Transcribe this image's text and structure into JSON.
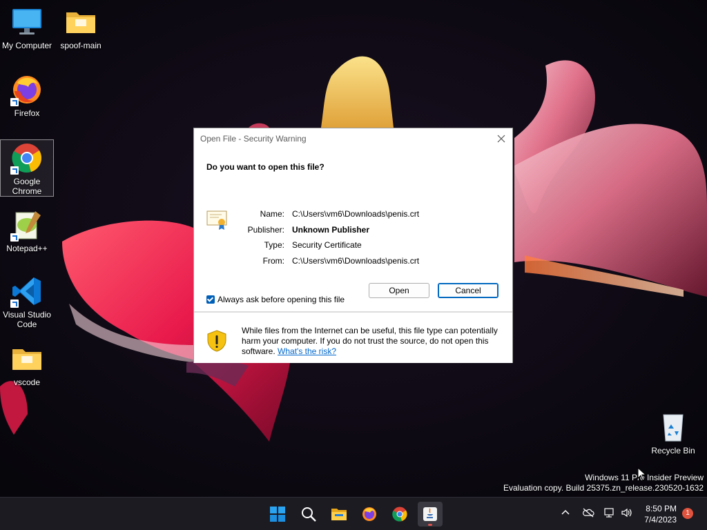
{
  "desktop": {
    "icons": [
      {
        "label": "My Computer",
        "icon": "monitor-icon"
      },
      {
        "label": "spoof-main",
        "icon": "folder-icon"
      },
      {
        "label": "Firefox",
        "icon": "firefox-icon"
      },
      {
        "label": "Google Chrome",
        "icon": "chrome-icon"
      },
      {
        "label": "Notepad++",
        "icon": "notepad-plus-plus-icon"
      },
      {
        "label": "Visual Studio Code",
        "icon": "vscode-icon"
      },
      {
        "label": "vscode",
        "icon": "folder-icon"
      },
      {
        "label": "Recycle Bin",
        "icon": "recycle-bin-icon"
      }
    ]
  },
  "dialog": {
    "title": "Open File - Security Warning",
    "question": "Do you want to open this file?",
    "fields": [
      {
        "label": "Name:",
        "value": "C:\\Users\\vm6\\Downloads\\penis.crt"
      },
      {
        "label": "Publisher:",
        "value": "Unknown Publisher"
      },
      {
        "label": "Type:",
        "value": "Security Certificate"
      },
      {
        "label": "From:",
        "value": "C:\\Users\\vm6\\Downloads\\penis.crt"
      }
    ],
    "open_label": "Open",
    "cancel_label": "Cancel",
    "checkbox_label": "Always ask before opening this file",
    "checkbox_checked": true,
    "warning_text": "While files from the Internet can be useful, this file type can potentially harm your computer. If you do not trust the source, do not open this software.",
    "risk_link": "What's the risk?"
  },
  "watermark": {
    "line1": "Windows 11 Pro Insider Preview",
    "line2": "Evaluation copy. Build 25375.zn_release.230520-1632"
  },
  "taskbar": {
    "apps": [
      "start-icon",
      "search-icon",
      "file-explorer-icon",
      "firefox-icon",
      "chrome-icon",
      "java-icon"
    ],
    "clock_time": "8:50 PM",
    "clock_date": "7/4/2023",
    "notification_count": "1"
  },
  "colors": {
    "accent": "#005fb8",
    "link": "#0066cc",
    "taskbar": "#1c1b22",
    "badge": "#e0533e"
  }
}
